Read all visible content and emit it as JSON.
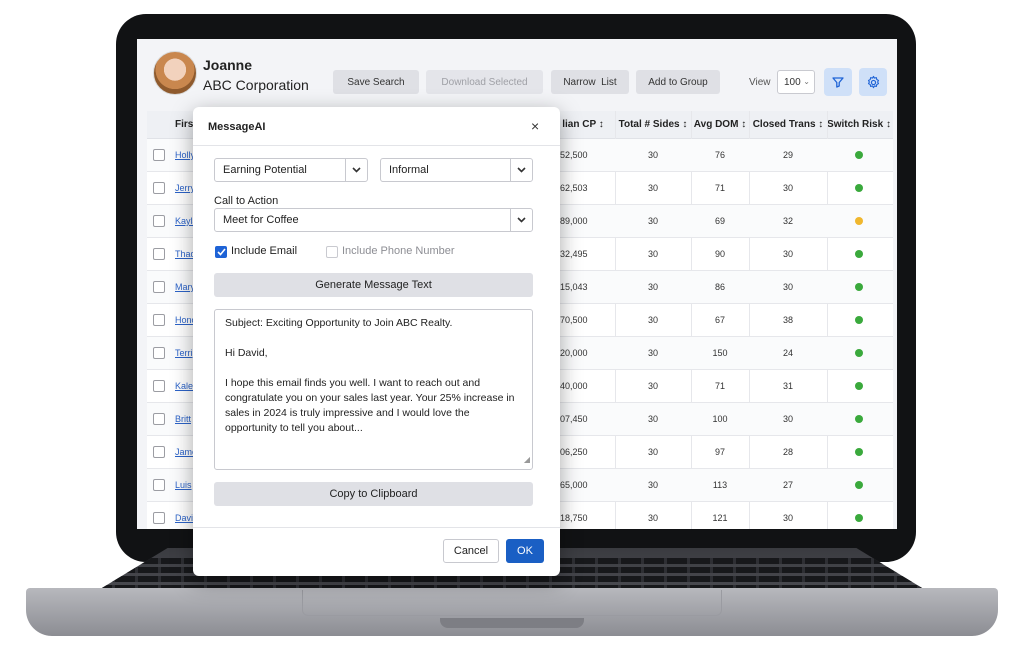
{
  "header": {
    "user_name": "Joanne",
    "company": "ABC Corporation",
    "save_search": "Save Search",
    "download_selected": "Download Selected",
    "narrow_list": "Narrow  List",
    "add_to_group": "Add to Group",
    "view_label": "View",
    "view_value": "100"
  },
  "table": {
    "columns": [
      "First",
      "lian CP ↕",
      "Total # Sides ↕",
      "Avg DOM ↕",
      "Closed Trans ↕",
      "Switch Risk ↕"
    ],
    "rows": [
      {
        "name": "Holly",
        "cp": "352,500",
        "sides": "30",
        "dom": "76",
        "closed": "29",
        "risk": "green"
      },
      {
        "name": "Jerry",
        "cp": "362,503",
        "sides": "30",
        "dom": "71",
        "closed": "30",
        "risk": "green"
      },
      {
        "name": "Kayla",
        "cp": "389,000",
        "sides": "30",
        "dom": "69",
        "closed": "32",
        "risk": "yellow"
      },
      {
        "name": "Thad",
        "cp": "332,495",
        "sides": "30",
        "dom": "90",
        "closed": "30",
        "risk": "green"
      },
      {
        "name": "Mary",
        "cp": "315,043",
        "sides": "30",
        "dom": "86",
        "closed": "30",
        "risk": "green"
      },
      {
        "name": "Honor",
        "cp": "470,500",
        "sides": "30",
        "dom": "67",
        "closed": "38",
        "risk": "green"
      },
      {
        "name": "Terri",
        "cp": "120,000",
        "sides": "30",
        "dom": "150",
        "closed": "24",
        "risk": "green"
      },
      {
        "name": "Kaleb",
        "cp": "240,000",
        "sides": "30",
        "dom": "71",
        "closed": "31",
        "risk": "green"
      },
      {
        "name": "Britt",
        "cp": "407,450",
        "sides": "30",
        "dom": "100",
        "closed": "30",
        "risk": "green"
      },
      {
        "name": "James",
        "cp": "206,250",
        "sides": "30",
        "dom": "97",
        "closed": "28",
        "risk": "green"
      },
      {
        "name": "Luis",
        "cp": "265,000",
        "sides": "30",
        "dom": "113",
        "closed": "27",
        "risk": "green"
      },
      {
        "name": "David",
        "cp": "318,750",
        "sides": "30",
        "dom": "121",
        "closed": "30",
        "risk": "green"
      }
    ]
  },
  "colors": {
    "green": "#3aa93c",
    "yellow": "#f0b72e",
    "primary": "#1a5fc4",
    "link": "#2c63c8"
  },
  "modal": {
    "title": "MessageAI",
    "close": "×",
    "topic": "Earning Potential",
    "tone": "Informal",
    "cta_label": "Call to Action",
    "cta_value": "Meet for Coffee",
    "include_email": "Include Email",
    "include_phone": "Include Phone Number",
    "generate": "Generate Message Text",
    "message": {
      "subject": "Subject: Exciting Opportunity to Join ABC Realty.",
      "greeting": "Hi David,",
      "body": "I hope this email finds you well. I want to reach out and congratulate you on your sales last year. Your 25% increase in sales in 2024 is truly impressive and I would love the opportunity to tell you about..."
    },
    "copy": "Copy to Clipboard",
    "cancel": "Cancel",
    "ok": "OK"
  }
}
